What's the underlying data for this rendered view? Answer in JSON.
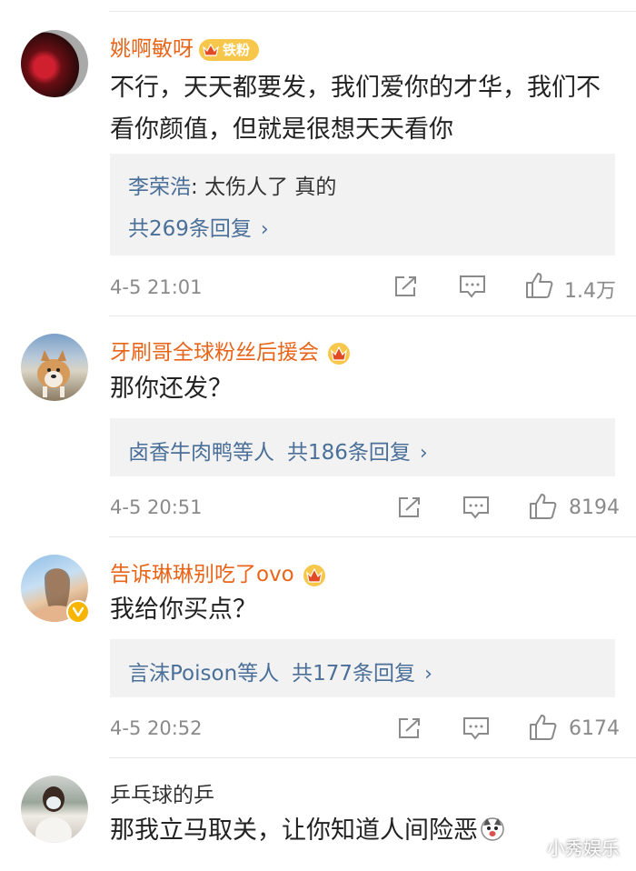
{
  "comments": [
    {
      "username": "姚啊敏呀",
      "fan_badge": "铁粉",
      "text": "不行，天天都要发，我们爱你的才华，我们不看你颜值，但就是很想天天看你",
      "reply_preview_user": "李荣浩",
      "reply_preview_text": "太伤人了 真的",
      "reply_count_label": "共269条回复",
      "timestamp": "4-5 21:01",
      "likes": "1.4万"
    },
    {
      "username": "牙刷哥全球粉丝后援会",
      "text": "那你还发？",
      "reply_users_label": "卤香牛肉鸭等人",
      "reply_count_label": "共186条回复",
      "timestamp": "4-5 20:51",
      "likes": "8194"
    },
    {
      "username": "告诉琳琳别吃了ovo",
      "text": "我给你买点？",
      "reply_users_label": "言沫Poison等人",
      "reply_count_label": "共177条回复",
      "timestamp": "4-5 20:52",
      "likes": "6174"
    },
    {
      "username": "乒乓球的乒",
      "text": "那我立马取关，让你知道人间险恶"
    }
  ],
  "watermark": "小秀娱乐",
  "icons": [
    "share-icon",
    "comment-icon",
    "like-icon",
    "crown-badge-icon",
    "verified-icon",
    "dog-emoji-icon",
    "weibo-logo-icon"
  ],
  "colors": {
    "username": "#e8651a",
    "link": "#4a6f98",
    "reply_bg": "#f2f2f2",
    "meta": "#8a8a8a"
  }
}
